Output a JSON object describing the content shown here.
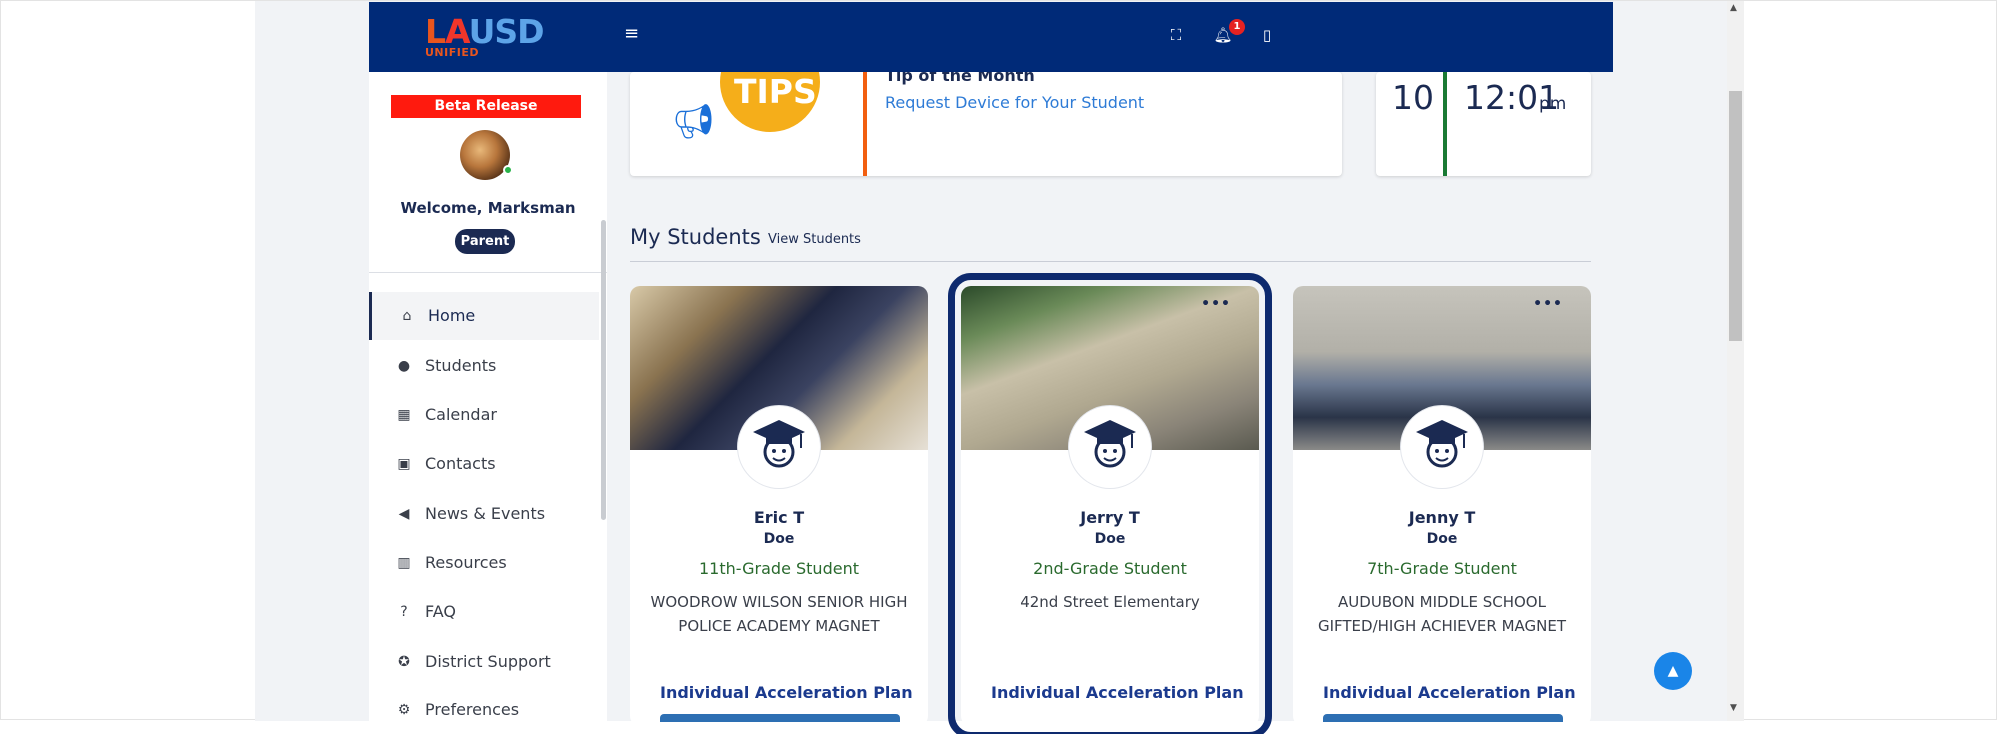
{
  "header": {
    "logo": {
      "letter_l": "L",
      "letter_a": "A",
      "letters_usd": "USD",
      "sub": "UNIFIED"
    },
    "menu_icon": "hamburger-icon",
    "icons": [
      "fullscreen-icon",
      "bell-icon",
      "sidebar-toggle-icon"
    ],
    "notification_count": "1",
    "colors": {
      "bar": "#002a78",
      "badge": "#e52222"
    }
  },
  "sidebar": {
    "beta_label": "Beta Release",
    "welcome": "Welcome, Marksman",
    "role": "Parent",
    "items": [
      {
        "label": "Home",
        "icon": "home-icon",
        "active": true
      },
      {
        "label": "Students",
        "icon": "user-icon"
      },
      {
        "label": "Calendar",
        "icon": "calendar-icon"
      },
      {
        "label": "Contacts",
        "icon": "contact-card-icon"
      },
      {
        "label": "News & Events",
        "icon": "megaphone-icon"
      },
      {
        "label": "Resources",
        "icon": "books-icon"
      },
      {
        "label": "FAQ",
        "icon": "question-icon"
      },
      {
        "label": "District Support",
        "icon": "lifebuoy-icon"
      },
      {
        "label": "Preferences",
        "icon": "gear-icon"
      }
    ]
  },
  "tip": {
    "image_text": "TIPS",
    "heading": "Tip of the Month",
    "link": "Request Device for Your Student",
    "accent": "#f25f10"
  },
  "date_time": {
    "day": "10",
    "time": "12:01",
    "ampm": "pm",
    "accent": "#1a7a34"
  },
  "students_section": {
    "title": "My Students",
    "view_link": "View Students",
    "students": [
      {
        "first": "Eric T",
        "last": "Doe",
        "grade": "11th-Grade Student",
        "school": "WOODROW WILSON SENIOR HIGH POLICE ACADEMY MAGNET",
        "plan": "Individual Acceleration Plan",
        "selected": false
      },
      {
        "first": "Jerry T",
        "last": "Doe",
        "grade": "2nd-Grade Student",
        "school": "42nd Street Elementary",
        "plan": "Individual Acceleration Plan",
        "selected": true
      },
      {
        "first": "Jenny T",
        "last": "Doe",
        "grade": "7th-Grade Student",
        "school": "AUDUBON MIDDLE SCHOOL GIFTED/HIGH ACHIEVER MAGNET",
        "plan": "Individual Acceleration Plan",
        "selected": false
      }
    ]
  },
  "misc": {
    "scroll_top_icon": "arrow-up-icon"
  }
}
